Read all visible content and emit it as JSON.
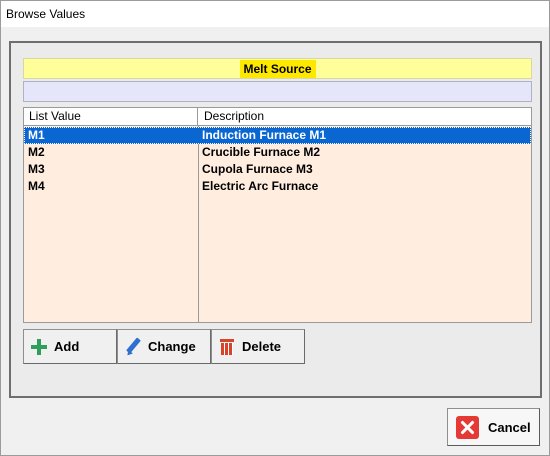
{
  "window": {
    "title": "Browse Values"
  },
  "panel": {
    "heading": "Melt Source",
    "filter": {
      "value": "",
      "placeholder": ""
    }
  },
  "grid": {
    "columns": [
      "List Value",
      "Description"
    ],
    "rows": [
      {
        "value": "M1",
        "description": "Induction Furnace M1",
        "selected": true
      },
      {
        "value": "M2",
        "description": "Crucible Furnace M2",
        "selected": false
      },
      {
        "value": "M3",
        "description": "Cupola Furnace M3",
        "selected": false
      },
      {
        "value": "M4",
        "description": "Electric Arc Furnace",
        "selected": false
      }
    ]
  },
  "actions": {
    "add": {
      "label": "Add",
      "icon": "plus-icon"
    },
    "change": {
      "label": "Change",
      "icon": "pencil-icon"
    },
    "delete": {
      "label": "Delete",
      "icon": "trash-icon"
    }
  },
  "footer": {
    "cancel": {
      "label": "Cancel",
      "icon": "close-icon"
    }
  },
  "colors": {
    "heading_bar": "#ffff99",
    "heading_label": "#ffe800",
    "filter_bg": "#e6e6fa",
    "grid_bg": "#ffede0",
    "selection": "#0a66d0",
    "cancel_icon": "#e53935"
  }
}
